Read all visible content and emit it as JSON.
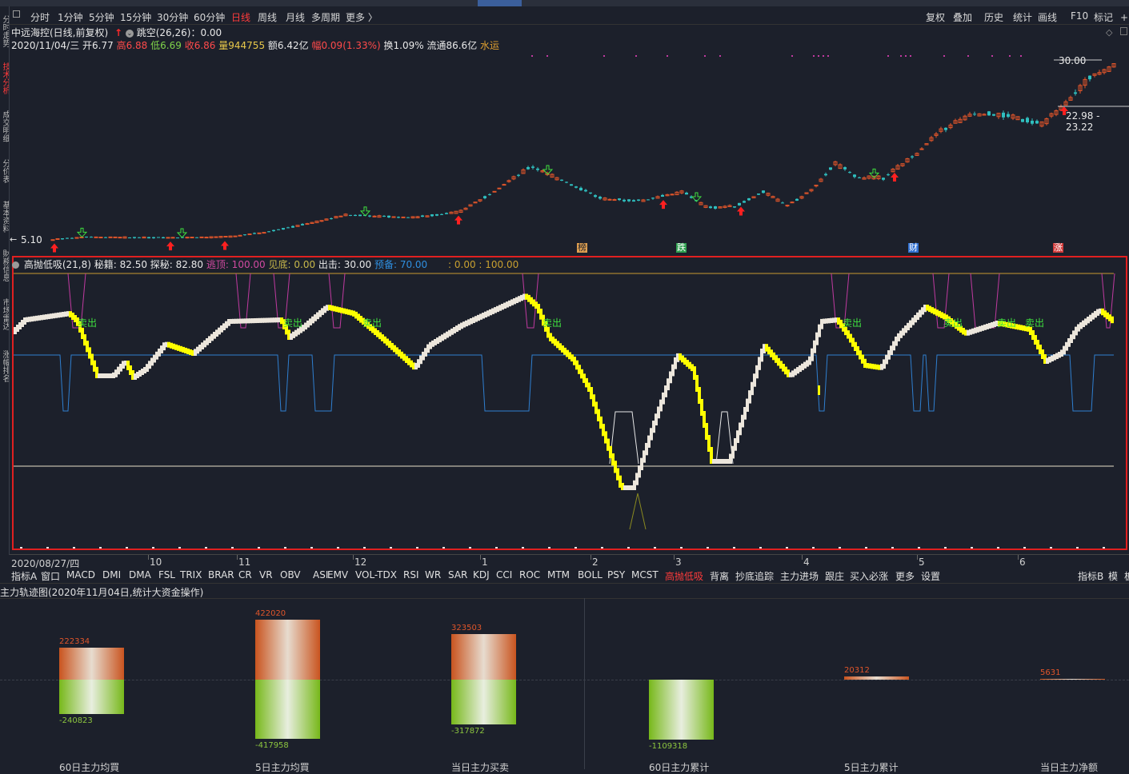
{
  "period_tabs": [
    {
      "label": "分时",
      "active": false
    },
    {
      "label": "1分钟",
      "active": false
    },
    {
      "label": "5分钟",
      "active": false
    },
    {
      "label": "15分钟",
      "active": false
    },
    {
      "label": "30分钟",
      "active": false
    },
    {
      "label": "60分钟",
      "active": false
    },
    {
      "label": "日线",
      "active": true
    },
    {
      "label": "周线",
      "active": false
    },
    {
      "label": "月线",
      "active": false
    },
    {
      "label": "多周期",
      "active": false
    },
    {
      "label": "更多 〉",
      "active": false
    }
  ],
  "right_tools": [
    "复权",
    "叠加",
    "历史",
    "统计",
    "画线",
    "F10",
    "标记",
    "+自"
  ],
  "side_tabs": [
    "分时走势",
    "技术分析",
    "成交明细",
    "分价表",
    "基本资料",
    "財務信息",
    "市场雷达",
    "涨幅排名"
  ],
  "header": {
    "stock_line": "中远海控(日线,前复权)",
    "gap_text": "跳空(26,26)：0.00",
    "date_open": "2020/11/04/三 开6.77",
    "high": "高6.88",
    "low": "低6.69",
    "close": "收6.86",
    "volume": "量944755",
    "amount": "额6.42亿",
    "change": "幅0.09(1.33%)",
    "turnover": "换1.09%",
    "float_cap": "流通86.6亿",
    "sector": "水运"
  },
  "kline": {
    "high_label": "30.00",
    "range_label": "22.98 - 23.22",
    "low_label": "5.10",
    "markers": [
      "榜",
      "跌",
      "财",
      "涨"
    ]
  },
  "indicator": {
    "name": "高抛低吸(21,8)",
    "params": "秘籍: 82.50 探秘: 82.80",
    "escape": "逃顶: 100.00",
    "bottom": "见底: 0.00",
    "strike": "出击: 30.00",
    "reserve": "预备: 70.00",
    "extra": ": 0.00 : 100.00",
    "sell_label": "卖出"
  },
  "date_axis": [
    "2020/08/27/四",
    "10",
    "11",
    "12",
    "1",
    "2",
    "3",
    "4",
    "5",
    "6"
  ],
  "indicator_tabs": [
    {
      "label": "指标A",
      "active": false
    },
    {
      "label": "窗口",
      "active": false
    },
    {
      "label": "MACD",
      "active": false
    },
    {
      "label": "DMI",
      "active": false
    },
    {
      "label": "DMA",
      "active": false
    },
    {
      "label": "FSL",
      "active": false
    },
    {
      "label": "TRIX",
      "active": false
    },
    {
      "label": "BRAR",
      "active": false
    },
    {
      "label": "CR",
      "active": false
    },
    {
      "label": "VR",
      "active": false
    },
    {
      "label": "OBV",
      "active": false
    },
    {
      "label": "ASI",
      "active": false
    },
    {
      "label": "EMV",
      "active": false
    },
    {
      "label": "VOL-TDX",
      "active": false
    },
    {
      "label": "RSI",
      "active": false
    },
    {
      "label": "WR",
      "active": false
    },
    {
      "label": "SAR",
      "active": false
    },
    {
      "label": "KDJ",
      "active": false
    },
    {
      "label": "CCI",
      "active": false
    },
    {
      "label": "ROC",
      "active": false
    },
    {
      "label": "MTM",
      "active": false
    },
    {
      "label": "BOLL",
      "active": false
    },
    {
      "label": "PSY",
      "active": false
    },
    {
      "label": "MCST",
      "active": false
    },
    {
      "label": "高抛低吸",
      "active": true
    },
    {
      "label": "背离",
      "active": false
    },
    {
      "label": "抄底追踪",
      "active": false
    },
    {
      "label": "主力进场",
      "active": false
    },
    {
      "label": "跟庄",
      "active": false
    },
    {
      "label": "买入必涨",
      "active": false
    },
    {
      "label": "更多",
      "active": false
    },
    {
      "label": "设置",
      "active": false
    }
  ],
  "indicator_tabs_right": [
    "指标B",
    "模",
    "板"
  ],
  "fund_panel": {
    "title": "主力轨迹图(2020年11月04日,统计大资金操作)",
    "bars": [
      {
        "caption": "60日主力均買",
        "up": 222334,
        "down": -240823
      },
      {
        "caption": "5日主力均買",
        "up": 422020,
        "down": -417958
      },
      {
        "caption": "当日主力买卖",
        "up": 323503,
        "down": -317872
      },
      {
        "caption": "60日主力累计",
        "up": null,
        "down": -1109318
      },
      {
        "caption": "5日主力累计",
        "up": 20312,
        "down": null
      },
      {
        "caption": "当日主力净额",
        "up": 5631,
        "down": null
      }
    ]
  },
  "colors": {
    "up": "#e0552a",
    "down": "#8dc63f",
    "accent_red": "#ff3b3b",
    "indicator_border": "#e02020",
    "osc_white": "#ece6dc",
    "osc_yellow": "#ffff00",
    "reserve_blue": "#2f7fd0",
    "escape_magenta": "#c03aa0"
  },
  "icons": [
    "window-menu-icon",
    "circle-down-icon",
    "red-up-arrow-icon",
    "diamond-icon",
    "scroll-up-icon"
  ]
}
